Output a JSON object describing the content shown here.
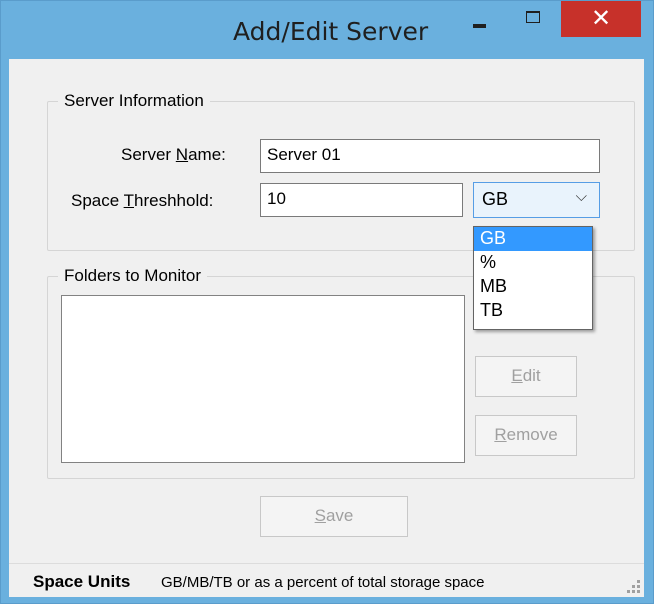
{
  "window": {
    "title": "Add/Edit Server",
    "controls": {
      "minimize": "minimize-icon",
      "maximize": "maximize-icon",
      "close": "close-icon",
      "close_glyph": "✕"
    }
  },
  "server_info": {
    "legend": "Server Information",
    "name_label_pre": "Server ",
    "name_label_access": "N",
    "name_label_post": "ame:",
    "name_value": "Server 01",
    "threshold_label_pre": "Space ",
    "threshold_label_access": "T",
    "threshold_label_post": "hreshhold:",
    "threshold_value": "10",
    "unit_selected": "GB",
    "unit_options": [
      "GB",
      "%",
      "MB",
      "TB"
    ]
  },
  "folders": {
    "legend": "Folders to Monitor",
    "edit_access": "E",
    "edit_rest": "dit",
    "remove_access": "R",
    "remove_rest": "emove"
  },
  "save": {
    "access": "S",
    "rest": "ave"
  },
  "status": {
    "title": "Space Units",
    "text": "GB/MB/TB or as a percent of total storage space"
  },
  "colors": {
    "titlebar": "#6ab0de",
    "close_button": "#c7312a",
    "selection": "#3399ff",
    "client": "#f0f0f0"
  }
}
